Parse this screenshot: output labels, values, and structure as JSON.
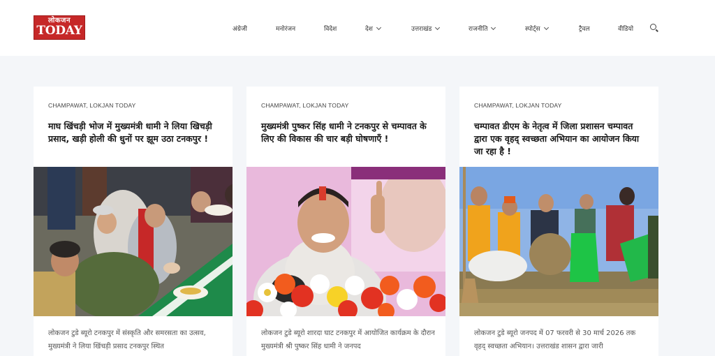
{
  "header": {
    "logo_top": "लोकजन",
    "logo_bottom": "TODAY",
    "nav": [
      {
        "label": "अंग्रेजी",
        "dropdown": false
      },
      {
        "label": "मनोरंजन",
        "dropdown": false
      },
      {
        "label": "विदेश",
        "dropdown": false
      },
      {
        "label": "देश",
        "dropdown": true
      },
      {
        "label": "उत्तराखंड",
        "dropdown": true
      },
      {
        "label": "राजनीति",
        "dropdown": true
      },
      {
        "label": "स्पोर्ट्स",
        "dropdown": true
      },
      {
        "label": "ट्रैवल",
        "dropdown": false
      },
      {
        "label": "वीडियो",
        "dropdown": false
      }
    ],
    "search_icon": "search-icon"
  },
  "cards": [
    {
      "category": "CHAMPAWAT, LOKJAN TODAY",
      "title": "माघ खिंचड़ी भोज में मुख्यमंत्री धामी ने लिया खिचड़ी प्रसाद, खड़ी होली की धुनों पर झूम उठा टनकपुर !",
      "excerpt": "लोकजन टुडे ब्यूरो टनकपुर में संस्कृति और समरसता का उत्सव, मुख्यमंत्री ने लिया खिंचड़ी प्रसाद टनकपुर स्थित"
    },
    {
      "category": "CHAMPAWAT, LOKJAN TODAY",
      "title": "मुख्यमंत्री पुष्कर सिंह धामी ने टनकपुर से चम्पावत के लिए की विकास की चार बड़ी घोषणाएँ !",
      "excerpt": "लोकजन टुडे ब्यूरो शारदा घाट टनकपुर में आयोजित कार्यक्रम के दौरान मुख्यमंत्री श्री पुष्कर सिंह धामी ने जनपद"
    },
    {
      "category": "CHAMPAWAT, LOKJAN TODAY",
      "title": "चम्पावत डीएम के नेतृत्व में जिला प्रशासन चम्पावत द्वारा एक वृहद् स्वच्छता अभियान का आयोजन किया जा रहा है !",
      "excerpt": "लोकजन टुडे ब्यूरो जनपद में 07 फरवरी से 30 मार्च 2026 तक वृहद् स्वच्छता अभियान। उत्तराखंड शासन द्वारा जारी"
    }
  ],
  "colors": {
    "logo_red": "#c62828",
    "page_bg": "#f4f6f9"
  }
}
